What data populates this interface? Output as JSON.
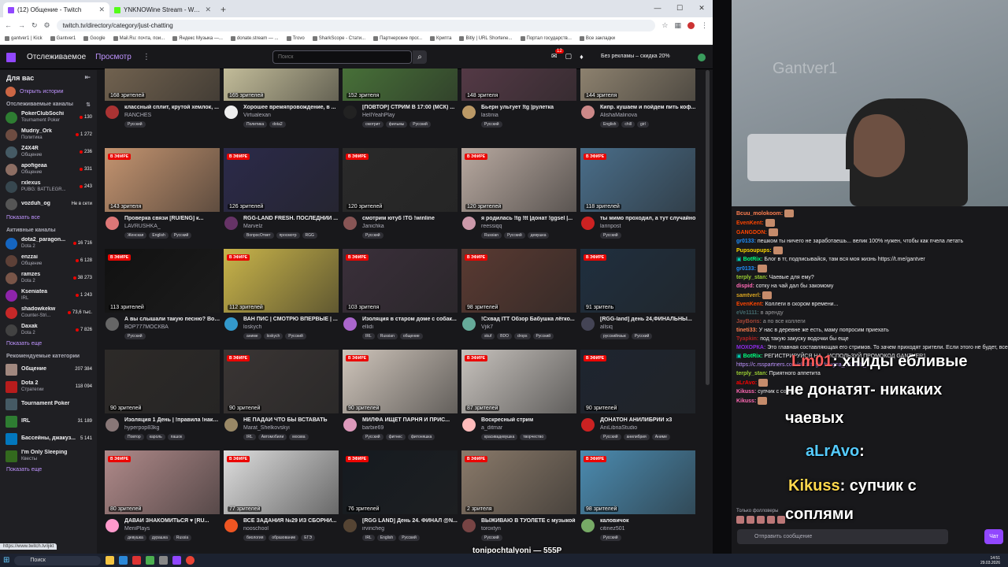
{
  "browser": {
    "tabs": [
      {
        "title": "(12) Общение - Twitch",
        "active": true
      },
      {
        "title": "YNKNOWine Stream - Watch L",
        "active": false
      }
    ],
    "url": "twitch.tv/directory/category/just-chatting",
    "bookmarks": [
      "gantver1 | Kick",
      "Gantver1",
      "Google",
      "Mail.Ru: почта, пои...",
      "Яндекс Музыка —...",
      "donate.stream — ...",
      "Trovo",
      "SharkScope - Стати...",
      "Партнерские прог...",
      "Крипта",
      "Bitly | URL Shortene...",
      "Портал государств...",
      "Все закладки"
    ],
    "status_url": "https://www.twitch.tv/ijikt"
  },
  "twitch": {
    "nav": {
      "following": "Отслеживаемое",
      "browse": "Просмотр",
      "search_placeholder": "Поиск",
      "notif_count": "12",
      "noads": "Без рекламы – скидка 20%"
    },
    "sidebar": {
      "header": "Для вас",
      "history": "Открыть истории",
      "followed_title": "Отслеживаемые каналы",
      "followed": [
        {
          "name": "PokerClubSochi",
          "game": "Tournament Poker",
          "viewers": "130",
          "color": "#2e7d32"
        },
        {
          "name": "Mudriy_Ork",
          "game": "Политика",
          "viewers": "1 272",
          "color": "#6d4c41"
        },
        {
          "name": "Z4X4R",
          "game": "Общение",
          "viewers": "236",
          "color": "#455a64"
        },
        {
          "name": "apofigeaa",
          "game": "Общение",
          "viewers": "331",
          "color": "#8d6e63"
        },
        {
          "name": "rxlexus",
          "game": "PUBG: BATTLEGR...",
          "viewers": "243",
          "color": "#37474f"
        },
        {
          "name": "vozduh_og",
          "game": "",
          "viewers": "Не в сети",
          "color": "#555"
        }
      ],
      "show_more": "Показать все",
      "active_title": "Активные каналы",
      "active": [
        {
          "name": "dota2_paragon...",
          "game": "Dota 2",
          "viewers": "16 716",
          "color": "#1565c0"
        },
        {
          "name": "enzzai",
          "game": "Общение",
          "viewers": "6 128",
          "color": "#5d4037"
        },
        {
          "name": "ramzes",
          "game": "Dota 2",
          "viewers": "38 273",
          "color": "#795548"
        },
        {
          "name": "Kseniatea",
          "game": "IRL",
          "viewers": "1 243",
          "color": "#8e24aa"
        },
        {
          "name": "shadowkekw",
          "game": "Counter-Stri...",
          "viewers": "73,6 тыс.",
          "color": "#c62828"
        },
        {
          "name": "Daxak",
          "game": "Dota 2",
          "viewers": "7 826",
          "color": "#424242"
        }
      ],
      "show_more2": "Показать еще",
      "rec_title": "Рекомендуемые категории",
      "categories": [
        {
          "name": "Общение",
          "game": "",
          "viewers": "207 384",
          "color": "#a1887f"
        },
        {
          "name": "Dota 2",
          "game": "Стратегии",
          "viewers": "118 094",
          "color": "#b71c1c"
        },
        {
          "name": "Tournament Poker",
          "game": "",
          "viewers": "",
          "color": "#455a64"
        },
        {
          "name": "IRL",
          "game": "",
          "viewers": "31 189",
          "color": "#2e7d32"
        },
        {
          "name": "Бассейны, джакуз...",
          "game": "",
          "viewers": "5 141",
          "color": "#0277bd"
        },
        {
          "name": "I'm Only Sleeping",
          "game": "Квесты",
          "viewers": "",
          "color": "#33691e"
        }
      ],
      "show_more3": "Показать еще"
    },
    "live_label": "В ЭФИРЕ",
    "cards": [
      {
        "viewers": "168 зрителей",
        "title": "классный сплит, крутой хемлок, ...",
        "name": "RANCHES",
        "tags": [
          "Русский"
        ],
        "bg": "#7b6a55",
        "av": "#a33",
        "live": false
      },
      {
        "viewers": "165 зрителей",
        "title": "Хорошее времяпровождение, в ...",
        "name": "Virtualexan",
        "tags": [
          "Политика",
          "dota2"
        ],
        "bg": "#d6cfa8",
        "av": "#eee",
        "live": false
      },
      {
        "viewers": "152 зрителя",
        "title": "[ПОВТОР] СТРИМ В 17:00 (МСК) ...",
        "name": "HellYeahPlay",
        "tags": [
          "смотрит",
          "фильмы",
          "Русский"
        ],
        "bg": "#4c7a3b",
        "av": "#222",
        "live": false
      },
      {
        "viewers": "148 зрителя",
        "title": "Бьерн ультует !tg |рулетка",
        "name": "lastinia",
        "tags": [
          "Русский"
        ],
        "bg": "#5a3c4a",
        "av": "#b96",
        "live": false
      },
      {
        "viewers": "144 зрителя",
        "title": "Кипр. кушаем и пойдем пить коф...",
        "name": "AlishaMalinova",
        "tags": [
          "English",
          "chill",
          "girl"
        ],
        "bg": "#9a8d78",
        "av": "#c88",
        "live": false
      },
      {
        "viewers": "143 зрителя",
        "title": "Проверка связи [RU/ENG] к...",
        "name": "LAVRUSHKA_",
        "tags": [
          "Женская",
          "English",
          "Русский"
        ],
        "bg": "#c49470",
        "av": "#d77",
        "live": true
      },
      {
        "viewers": "126 зрителей",
        "title": "RGG-LAND FRESH. ПОСЛЕДНИЙ ...",
        "name": "Marvelz",
        "tags": [
          "ВопросОтвет",
          "просмотр",
          "RGG"
        ],
        "bg": "#2b2a4a",
        "av": "#636",
        "live": true
      },
      {
        "viewers": "120 зрителей",
        "title": "смотрим ютуб !TG !winline",
        "name": "Janichka",
        "tags": [
          "Русский"
        ],
        "bg": "#2a2a2a",
        "av": "#855",
        "live": true
      },
      {
        "viewers": "120 зрителей",
        "title": "я родилась !tg !tt |донат !ggsel |...",
        "name": "reessiqq",
        "tags": [
          "Russian",
          "Русский",
          "девушка"
        ],
        "bg": "#b8a9a0",
        "av": "#c9a",
        "live": true
      },
      {
        "viewers": "118 зрителей",
        "title": "ты мимо проходил, а тут случайно",
        "name": "larinpost",
        "tags": [
          "Русский"
        ],
        "bg": "#4a6e8a",
        "av": "#c22",
        "live": true
      },
      {
        "viewers": "113 зрителей",
        "title": "А вы слышали такую песню? Воз...",
        "name": "ВОР777МОСКВА",
        "tags": [
          "Русский"
        ],
        "bg": "#111",
        "av": "#666",
        "live": true
      },
      {
        "viewers": "112 зрителей",
        "title": "ВАН ПИС | СМОТРЮ ВПЕРВЫЕ | ...",
        "name": "loskych",
        "tags": [
          "аниме",
          "loskych",
          "Русский"
        ],
        "bg": "#c9b44a",
        "av": "#39c",
        "live": true
      },
      {
        "viewers": "103 зрителя",
        "title": "Изоляция в старом доме с собак...",
        "name": "ellidi",
        "tags": [
          "IRL",
          "Russian",
          "общение"
        ],
        "bg": "#3a2f3a",
        "av": "#a6c",
        "live": true
      },
      {
        "viewers": "98 зрителей",
        "title": "!Схвад ITT Обзор Бабушка лёгко...",
        "name": "Vjik7",
        "tags": [
          "skuf",
          "BDO",
          "drops",
          "Русский"
        ],
        "bg": "#5a3a32",
        "av": "#6a9",
        "live": true
      },
      {
        "viewers": "91 зритель",
        "title": "[RGG-land] день 24,ФИНАЛЬНЫ...",
        "name": "allsiq",
        "tags": [
          "русскийязык",
          "Русский"
        ],
        "bg": "#1f2f3f",
        "av": "#445",
        "live": true
      },
      {
        "viewers": "90 зрителей",
        "title": "Изоляция 1 День | !правила !нака...",
        "name": "hyperpop83kg",
        "tags": [
          "Повтор",
          "кароль",
          "пашок"
        ],
        "bg": "#2d2a28",
        "av": "#877",
        "live": false
      },
      {
        "viewers": "90 зрителей",
        "title": "НЕ ПАДАЙ ЧТО БЫ ВСТАВАТЬ",
        "name": "Marat_Shelkovskyi",
        "tags": [
          "IRL",
          "Автомобили",
          "москва"
        ],
        "bg": "#3a3534",
        "av": "#986",
        "live": true
      },
      {
        "viewers": "90 зрителей",
        "title": "МИЛФА ИЩЕТ ПАРНЯ И ПРИС...",
        "name": "barbie69",
        "tags": [
          "Русский",
          "фитнес",
          "фитоняшка"
        ],
        "bg": "#cfc5bb",
        "av": "#d9b",
        "live": true
      },
      {
        "viewers": "87 зрителей",
        "title": "Воскресный стрим",
        "name": "a_ditmar",
        "tags": [
          "красивадевушка",
          "творчество"
        ],
        "bg": "#c7c2bd",
        "av": "#fbb",
        "live": true
      },
      {
        "viewers": "90 зрителей",
        "title": "ДОНАТОН АНИЛИБРИИ x3",
        "name": "AniLibriaStudio",
        "tags": [
          "Русский",
          "анилибрия",
          "Аниме"
        ],
        "bg": "#1e2530",
        "av": "#c22",
        "live": true
      },
      {
        "viewers": "80 зрителей",
        "title": "ДАВАЙ ЗНАКОМИТЬСЯ ♥ [RU...",
        "name": "MeriiPlays",
        "tags": [
          "девушка",
          "дурашка",
          "Russia"
        ],
        "bg": "#b08a8a",
        "av": "#f9c",
        "live": true
      },
      {
        "viewers": "77 зрителей",
        "title": "ВСЕ ЗАДАНИЯ №29 ИЗ СБОРНИ...",
        "name": "nooschool",
        "tags": [
          "биология",
          "образование",
          "ЕГЭ"
        ],
        "bg": "#dedede",
        "av": "#e52",
        "live": true
      },
      {
        "viewers": "76 зрителей",
        "title": "[RGG LAND] День 24. ФИНАЛ @N...",
        "name": "irvincheg",
        "tags": [
          "IRL",
          "English",
          "Русский"
        ],
        "bg": "#151a20",
        "av": "#543",
        "live": true
      },
      {
        "viewers": "2 зрителя",
        "title": "ВЫЖИВАЮ В ТУОЛЕТЕ с музыкой",
        "name": "toroxtyn",
        "tags": [
          "Русский"
        ],
        "bg": "#8a7a6a",
        "av": "#744",
        "live": true
      },
      {
        "viewers": "98 зрителей",
        "title": "каловичок",
        "name": "citinez501",
        "tags": [
          "Русский"
        ],
        "bg": "#4b8bb0",
        "av": "#7a6",
        "live": true
      }
    ]
  },
  "chat": {
    "lines": [
      {
        "user": "Bcuu_molokoom:",
        "color": "#ff7f50",
        "text": ""
      },
      {
        "user": "EvenKent:",
        "color": "#ff4500",
        "text": ""
      },
      {
        "user": "GANGDON:",
        "color": "#ff4500",
        "text": ""
      },
      {
        "user": "gr0133:",
        "color": "#1e90ff",
        "text": "пешком ты ничего не заработаешь... велик 100% нужен, чтобы как пчела летать"
      },
      {
        "user": "Pupsoupups:",
        "color": "#ffd700",
        "text": ""
      },
      {
        "user": "BotRix:",
        "color": "#00ff7f",
        "text": "Блог в тг, подписывайся, там вся моя жизнь https://t.me/gantver"
      },
      {
        "user": "gr0133:",
        "color": "#1e90ff",
        "text": ""
      },
      {
        "user": "terply_stan:",
        "color": "#9acd32",
        "text": "Чаевые для ему?"
      },
      {
        "user": "dispid:",
        "color": "#ff69b4",
        "text": "сотку на чай дал бы закомому"
      },
      {
        "user": "samtverl:",
        "color": "#daa520",
        "text": ""
      },
      {
        "user": "EvenKent:",
        "color": "#ff4500",
        "text": "Коллеги в скором времени..."
      },
      {
        "user": "eVe1111:",
        "color": "#5f9ea0",
        "text": "в аренду"
      },
      {
        "user": "JayBoris:",
        "color": "#ff6347",
        "text": "а по все коллеги"
      },
      {
        "user": "tineti33:",
        "color": "#ff7f50",
        "text": "У нас в деревне же есть, маму попросим приехать"
      },
      {
        "user": "Tyapkin:",
        "color": "#b22222",
        "text": "под такую закуску водочки бы еще"
      },
      {
        "user": "МОХОРКА:",
        "color": "#8a2be2",
        "text": "Это главная составляющая его стримов. То зачем приходят зрители. Если этого не будет, все закончится. В том числе и ты."
      },
      {
        "user": "BotRix:",
        "color": "#00ff7f",
        "text": "РЕГИСТРИРУЙСЯ НА... ИСПОЛЬЗУЙ ПРОМОКОД GANTVER1"
      },
      {
        "user": "",
        "color": "#bf94ff",
        "text": "https://c.rsspartners.com/clickthrgh?btag=a_13128b_..."
      },
      {
        "user": "terply_stan:",
        "color": "#9acd32",
        "text": "Приятного аппетита"
      },
      {
        "user": "aLrAvo:",
        "color": "#ff0000",
        "text": ""
      },
      {
        "user": "Kikuss:",
        "color": "#ff69b4",
        "text": "супчик с соплями"
      },
      {
        "user": "Kikuss:",
        "color": "#ff69b4",
        "text": ""
      }
    ],
    "overlays": [
      {
        "user": "Lm01",
        "text": ": хниды ебливые"
      },
      {
        "user": "",
        "text": "не донатят- никаких"
      },
      {
        "user": "",
        "text": "чаевых"
      },
      {
        "user": "aLrAvo",
        "text": ":"
      },
      {
        "user": "Kikuss",
        "text": ": супчик с"
      },
      {
        "user": "",
        "text": "соплями"
      }
    ],
    "mode": "Только фолловеры",
    "input_placeholder": "Отправить сообщение",
    "send": "Чат"
  },
  "stream": {
    "watermark": "Gantver1",
    "ticker": "tonipochtalyoni — 555P"
  },
  "taskbar": {
    "search": "Поиск",
    "time": "14:51",
    "date": "29.03.2026"
  }
}
